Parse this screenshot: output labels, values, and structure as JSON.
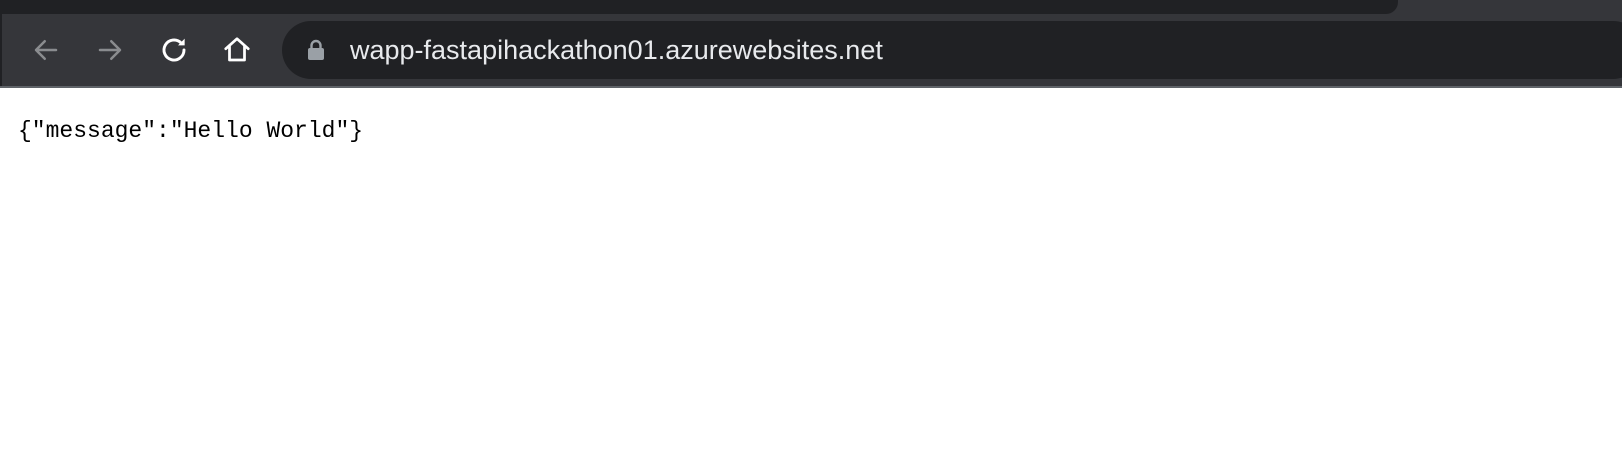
{
  "browser": {
    "address_bar": {
      "url": "wapp-fastapihackathon01.azurewebsites.net",
      "secure": true
    },
    "toolbar": {
      "buttons": [
        "back-icon",
        "forward-icon",
        "reload-icon",
        "home-icon"
      ]
    }
  },
  "page": {
    "body_text": "{\"message\":\"Hello World\"}"
  },
  "colors": {
    "toolbar_bg": "#35363a",
    "omnibox_bg": "#202124",
    "icon_active": "#ffffff",
    "icon_disabled": "#8a8c8f",
    "page_bg": "#ffffff"
  }
}
